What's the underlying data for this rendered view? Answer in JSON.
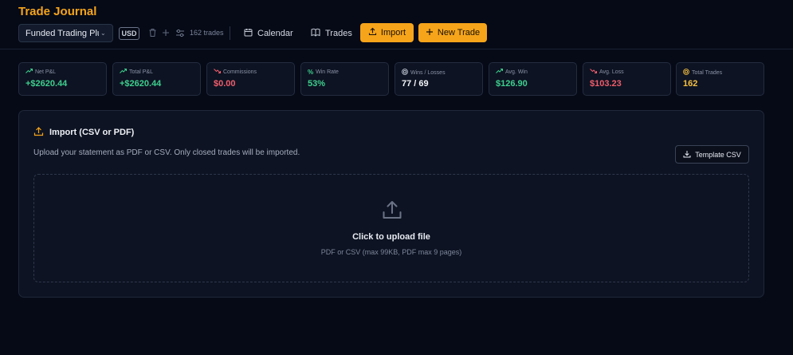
{
  "app": {
    "title": "Trade Journal"
  },
  "header": {
    "account_select": "Funded Trading Plus",
    "currency": "USD",
    "trade_count": "162 trades",
    "nav": {
      "calendar": "Calendar",
      "trades": "Trades"
    },
    "import_label": "Import",
    "new_trade_label": "New Trade"
  },
  "stats": [
    {
      "label": "Net P&L",
      "value": "+$2620.44",
      "icon": "trending-up-icon",
      "color": "#3ecf8e"
    },
    {
      "label": "Total P&L",
      "value": "+$2620.44",
      "icon": "trending-up-icon",
      "color": "#3ecf8e"
    },
    {
      "label": "Commissions",
      "value": "$0.00",
      "icon": "trending-down-icon",
      "color": "#f05d6c"
    },
    {
      "label": "Win Rate",
      "value": "53%",
      "icon": "percent-icon",
      "color": "#3ecf8e"
    },
    {
      "label": "Wins / Losses",
      "value": "77 / 69",
      "icon": "target-icon",
      "color": "#f2f4f8"
    },
    {
      "label": "Avg. Win",
      "value": "$126.90",
      "icon": "trending-up-icon",
      "color": "#3ecf8e"
    },
    {
      "label": "Avg. Loss",
      "value": "$103.23",
      "icon": "trending-down-icon",
      "color": "#f05d6c"
    },
    {
      "label": "Total Trades",
      "value": "162",
      "icon": "target-icon",
      "color": "#f6c042"
    }
  ],
  "import_panel": {
    "title": "Import (CSV or PDF)",
    "description": "Upload your statement as PDF or CSV. Only closed trades will be imported.",
    "template_button": "Template CSV",
    "dropzone_title": "Click to upload file",
    "dropzone_subtitle": "PDF or CSV (max 99KB, PDF max 9 pages)"
  },
  "colors": {
    "accent": "#f6a41a",
    "positive": "#3ecf8e",
    "negative": "#f05d6c",
    "background": "#060a17"
  }
}
